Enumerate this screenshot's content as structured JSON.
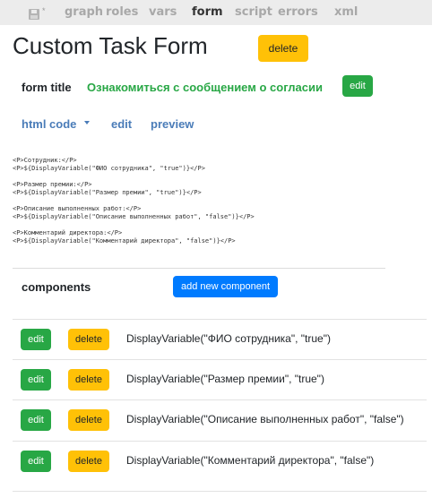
{
  "nav": {
    "star": "*",
    "items": [
      {
        "label": "graph"
      },
      {
        "label": "roles"
      },
      {
        "label": "vars"
      },
      {
        "label": "form"
      },
      {
        "label": "script"
      },
      {
        "label": "errors"
      },
      {
        "label": "xml"
      }
    ],
    "active": "form"
  },
  "page": {
    "title": "Custom Task Form",
    "delete_label": "delete"
  },
  "form_title": {
    "label": "form title",
    "value": "Ознакомиться с сообщением о согласии",
    "edit_label": "edit"
  },
  "html_tabs": {
    "code_label": "html code",
    "edit_label": "edit",
    "preview_label": "preview"
  },
  "html_code": "<P>Сотрудник:</P>\n<P>${DisplayVariable(\"ФИО сотрудника\", \"true\")}</P>\n\n<P>Размер премии:</P>\n<P>${DisplayVariable(\"Размер премии\", \"true\")}</P>\n\n<P>Описание выполненных работ:</P>\n<P>${DisplayVariable(\"Описание выполненных работ\", \"false\")}</P>\n\n<P>Комментарий директора:</P>\n<P>${DisplayVariable(\"Комментарий директора\", \"false\")}</P>",
  "components": {
    "heading": "components",
    "add_label": "add new component",
    "edit_label": "edit",
    "delete_label": "delete",
    "items": [
      {
        "text": "DisplayVariable(\"ФИО сотрудника\", \"true\")"
      },
      {
        "text": "DisplayVariable(\"Размер премии\", \"true\")"
      },
      {
        "text": "DisplayVariable(\"Описание выполненных работ\", \"false\")"
      },
      {
        "text": "DisplayVariable(\"Комментарий директора\", \"false\")"
      }
    ]
  },
  "colors": {
    "warning": "#ffc107",
    "success": "#28a745",
    "primary": "#007bff",
    "link": "#4a7cb8"
  }
}
